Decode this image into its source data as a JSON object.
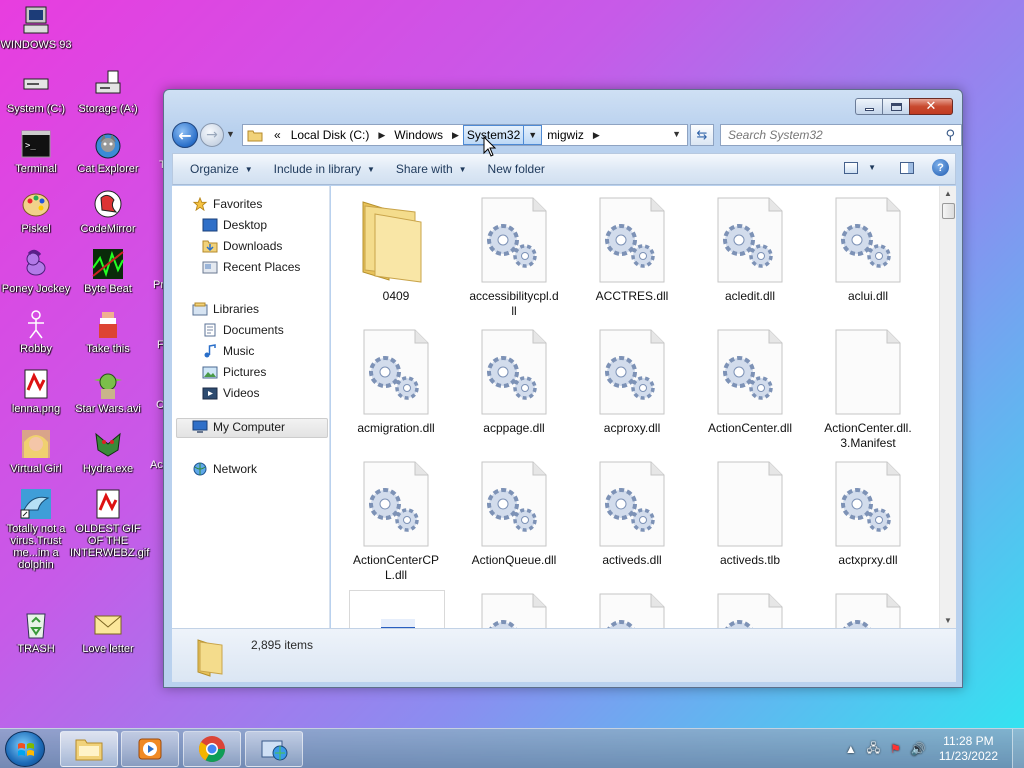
{
  "desktop": {
    "icons": [
      {
        "label": "WINDOWS 93"
      },
      {
        "label": "System (C:)"
      },
      {
        "label": "Storage (A:)"
      },
      {
        "label": "Terminal"
      },
      {
        "label": "Cat Explorer"
      },
      {
        "label": "Piskel"
      },
      {
        "label": "CodeMirror"
      },
      {
        "label": "Poney Jockey"
      },
      {
        "label": "Byte Beat"
      },
      {
        "label": "Robby"
      },
      {
        "label": "Take this"
      },
      {
        "label": "lenna.png"
      },
      {
        "label": "Star Wars.avi"
      },
      {
        "label": "Virtual Girl"
      },
      {
        "label": "Hydra.exe"
      },
      {
        "label": "Totally not a virus.Trust me...im a dolphin"
      },
      {
        "label": "OLDEST GIF OF THE INTERWEBZ.gif"
      },
      {
        "label": "TRASH"
      },
      {
        "label": "Love letter"
      }
    ],
    "cut_labels": [
      "T",
      "Pr",
      "F",
      "C",
      "Ac"
    ]
  },
  "window": {
    "address": {
      "overflow": "«",
      "crumbs": [
        "Local Disk (C:)",
        "Windows",
        "System32",
        "migwiz"
      ]
    },
    "search_placeholder": "Search System32",
    "toolbar": {
      "organize": "Organize",
      "include": "Include in library",
      "share": "Share with",
      "new_folder": "New folder"
    },
    "nav_pane": {
      "favorites": "Favorites",
      "desktop": "Desktop",
      "downloads": "Downloads",
      "recent": "Recent Places",
      "libraries": "Libraries",
      "documents": "Documents",
      "music": "Music",
      "pictures": "Pictures",
      "videos": "Videos",
      "my_computer": "My Computer",
      "network": "Network"
    },
    "files": [
      {
        "name": "0409",
        "icon": "folder-icon"
      },
      {
        "name": "accessibilitycpl.dll",
        "icon": "gear-file-icon"
      },
      {
        "name": "ACCTRES.dll",
        "icon": "gear-file-icon"
      },
      {
        "name": "acledit.dll",
        "icon": "gear-file-icon"
      },
      {
        "name": "aclui.dll",
        "icon": "gear-file-icon"
      },
      {
        "name": "acmigration.dll",
        "icon": "gear-file-icon"
      },
      {
        "name": "acppage.dll",
        "icon": "gear-file-icon"
      },
      {
        "name": "acproxy.dll",
        "icon": "gear-file-icon"
      },
      {
        "name": "ActionCenter.dll",
        "icon": "gear-file-icon"
      },
      {
        "name": "ActionCenter.dll.3.Manifest",
        "icon": "blank-file-icon"
      },
      {
        "name": "ActionCenterCPL.dll",
        "icon": "gear-file-icon"
      },
      {
        "name": "ActionQueue.dll",
        "icon": "gear-file-icon"
      },
      {
        "name": "activeds.dll",
        "icon": "gear-file-icon"
      },
      {
        "name": "activeds.tlb",
        "icon": "blank-file-icon"
      },
      {
        "name": "actxprxy.dll",
        "icon": "gear-file-icon"
      }
    ],
    "details": {
      "item_count": "2,895 items"
    }
  },
  "taskbar": {
    "clock_time": "11:28 PM",
    "clock_date": "11/23/2022"
  },
  "colors": {
    "accent": "#2a6fc9",
    "desktop_gradient_start": "#e83ddf",
    "desktop_gradient_end": "#2ee8f0"
  }
}
